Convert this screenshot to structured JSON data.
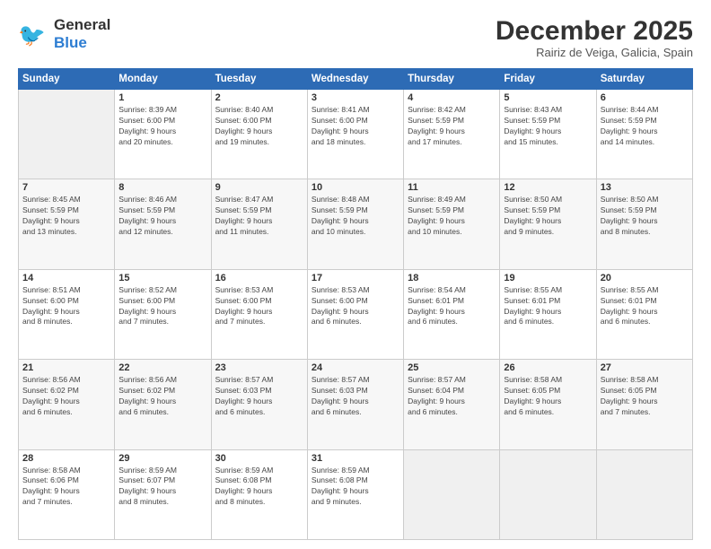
{
  "header": {
    "logo_general": "General",
    "logo_blue": "Blue",
    "title": "December 2025",
    "location": "Rairiz de Veiga, Galicia, Spain"
  },
  "weekdays": [
    "Sunday",
    "Monday",
    "Tuesday",
    "Wednesday",
    "Thursday",
    "Friday",
    "Saturday"
  ],
  "weeks": [
    [
      {
        "day": "",
        "info": ""
      },
      {
        "day": "1",
        "info": "Sunrise: 8:39 AM\nSunset: 6:00 PM\nDaylight: 9 hours\nand 20 minutes."
      },
      {
        "day": "2",
        "info": "Sunrise: 8:40 AM\nSunset: 6:00 PM\nDaylight: 9 hours\nand 19 minutes."
      },
      {
        "day": "3",
        "info": "Sunrise: 8:41 AM\nSunset: 6:00 PM\nDaylight: 9 hours\nand 18 minutes."
      },
      {
        "day": "4",
        "info": "Sunrise: 8:42 AM\nSunset: 5:59 PM\nDaylight: 9 hours\nand 17 minutes."
      },
      {
        "day": "5",
        "info": "Sunrise: 8:43 AM\nSunset: 5:59 PM\nDaylight: 9 hours\nand 15 minutes."
      },
      {
        "day": "6",
        "info": "Sunrise: 8:44 AM\nSunset: 5:59 PM\nDaylight: 9 hours\nand 14 minutes."
      }
    ],
    [
      {
        "day": "7",
        "info": "Sunrise: 8:45 AM\nSunset: 5:59 PM\nDaylight: 9 hours\nand 13 minutes."
      },
      {
        "day": "8",
        "info": "Sunrise: 8:46 AM\nSunset: 5:59 PM\nDaylight: 9 hours\nand 12 minutes."
      },
      {
        "day": "9",
        "info": "Sunrise: 8:47 AM\nSunset: 5:59 PM\nDaylight: 9 hours\nand 11 minutes."
      },
      {
        "day": "10",
        "info": "Sunrise: 8:48 AM\nSunset: 5:59 PM\nDaylight: 9 hours\nand 10 minutes."
      },
      {
        "day": "11",
        "info": "Sunrise: 8:49 AM\nSunset: 5:59 PM\nDaylight: 9 hours\nand 10 minutes."
      },
      {
        "day": "12",
        "info": "Sunrise: 8:50 AM\nSunset: 5:59 PM\nDaylight: 9 hours\nand 9 minutes."
      },
      {
        "day": "13",
        "info": "Sunrise: 8:50 AM\nSunset: 5:59 PM\nDaylight: 9 hours\nand 8 minutes."
      }
    ],
    [
      {
        "day": "14",
        "info": "Sunrise: 8:51 AM\nSunset: 6:00 PM\nDaylight: 9 hours\nand 8 minutes."
      },
      {
        "day": "15",
        "info": "Sunrise: 8:52 AM\nSunset: 6:00 PM\nDaylight: 9 hours\nand 7 minutes."
      },
      {
        "day": "16",
        "info": "Sunrise: 8:53 AM\nSunset: 6:00 PM\nDaylight: 9 hours\nand 7 minutes."
      },
      {
        "day": "17",
        "info": "Sunrise: 8:53 AM\nSunset: 6:00 PM\nDaylight: 9 hours\nand 6 minutes."
      },
      {
        "day": "18",
        "info": "Sunrise: 8:54 AM\nSunset: 6:01 PM\nDaylight: 9 hours\nand 6 minutes."
      },
      {
        "day": "19",
        "info": "Sunrise: 8:55 AM\nSunset: 6:01 PM\nDaylight: 9 hours\nand 6 minutes."
      },
      {
        "day": "20",
        "info": "Sunrise: 8:55 AM\nSunset: 6:01 PM\nDaylight: 9 hours\nand 6 minutes."
      }
    ],
    [
      {
        "day": "21",
        "info": "Sunrise: 8:56 AM\nSunset: 6:02 PM\nDaylight: 9 hours\nand 6 minutes."
      },
      {
        "day": "22",
        "info": "Sunrise: 8:56 AM\nSunset: 6:02 PM\nDaylight: 9 hours\nand 6 minutes."
      },
      {
        "day": "23",
        "info": "Sunrise: 8:57 AM\nSunset: 6:03 PM\nDaylight: 9 hours\nand 6 minutes."
      },
      {
        "day": "24",
        "info": "Sunrise: 8:57 AM\nSunset: 6:03 PM\nDaylight: 9 hours\nand 6 minutes."
      },
      {
        "day": "25",
        "info": "Sunrise: 8:57 AM\nSunset: 6:04 PM\nDaylight: 9 hours\nand 6 minutes."
      },
      {
        "day": "26",
        "info": "Sunrise: 8:58 AM\nSunset: 6:05 PM\nDaylight: 9 hours\nand 6 minutes."
      },
      {
        "day": "27",
        "info": "Sunrise: 8:58 AM\nSunset: 6:05 PM\nDaylight: 9 hours\nand 7 minutes."
      }
    ],
    [
      {
        "day": "28",
        "info": "Sunrise: 8:58 AM\nSunset: 6:06 PM\nDaylight: 9 hours\nand 7 minutes."
      },
      {
        "day": "29",
        "info": "Sunrise: 8:59 AM\nSunset: 6:07 PM\nDaylight: 9 hours\nand 8 minutes."
      },
      {
        "day": "30",
        "info": "Sunrise: 8:59 AM\nSunset: 6:08 PM\nDaylight: 9 hours\nand 8 minutes."
      },
      {
        "day": "31",
        "info": "Sunrise: 8:59 AM\nSunset: 6:08 PM\nDaylight: 9 hours\nand 9 minutes."
      },
      {
        "day": "",
        "info": ""
      },
      {
        "day": "",
        "info": ""
      },
      {
        "day": "",
        "info": ""
      }
    ]
  ]
}
